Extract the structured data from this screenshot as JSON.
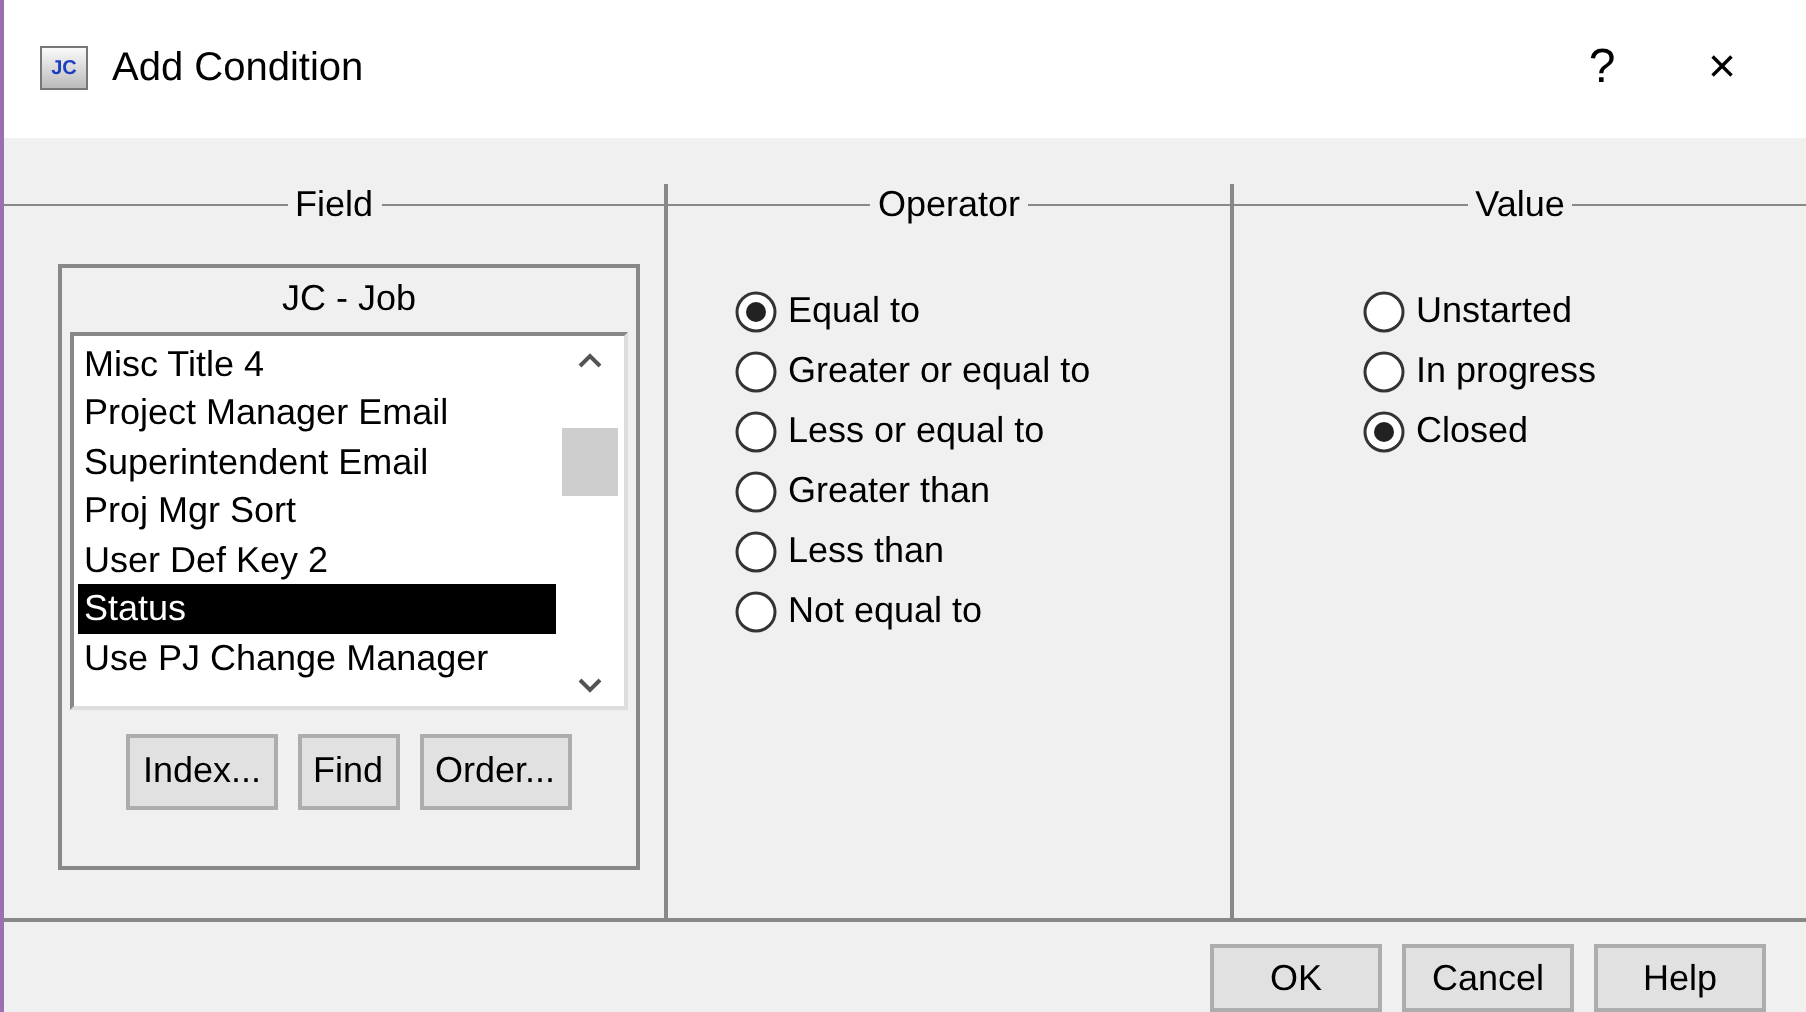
{
  "window": {
    "title": "Add Condition",
    "icon_text": "JC",
    "help": "?",
    "close": "×"
  },
  "field": {
    "heading": "Field",
    "table": "JC - Job",
    "items": [
      {
        "label": "Misc Title 4",
        "selected": false
      },
      {
        "label": "Project Manager Email",
        "selected": false
      },
      {
        "label": "Superintendent Email",
        "selected": false
      },
      {
        "label": "Proj Mgr Sort",
        "selected": false
      },
      {
        "label": "User Def Key 2",
        "selected": false
      },
      {
        "label": "Status",
        "selected": true
      },
      {
        "label": "Use PJ Change Manager",
        "selected": false
      }
    ],
    "buttons": [
      "Index...",
      "Find",
      "Order..."
    ]
  },
  "operator": {
    "heading": "Operator",
    "options": [
      {
        "label": "Equal to",
        "selected": true
      },
      {
        "label": "Greater or equal to",
        "selected": false
      },
      {
        "label": "Less or equal to",
        "selected": false
      },
      {
        "label": "Greater than",
        "selected": false
      },
      {
        "label": "Less than",
        "selected": false
      },
      {
        "label": "Not equal to",
        "selected": false
      }
    ]
  },
  "value": {
    "heading": "Value",
    "options": [
      {
        "label": "Unstarted",
        "selected": false
      },
      {
        "label": "In progress",
        "selected": false
      },
      {
        "label": "Closed",
        "selected": true
      }
    ]
  },
  "buttons": [
    "OK",
    "Cancel",
    "Help"
  ]
}
